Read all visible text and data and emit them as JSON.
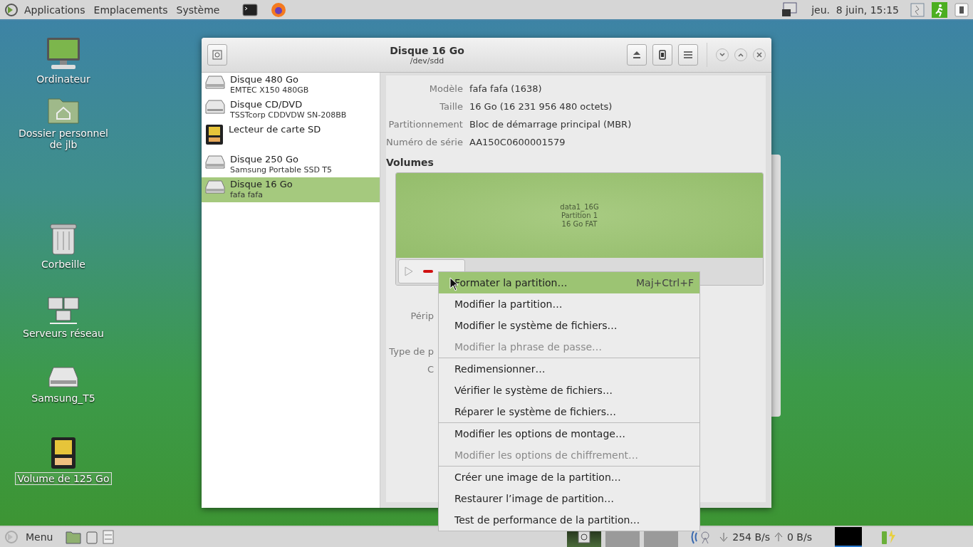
{
  "top_panel": {
    "menus": [
      "Applications",
      "Emplacements",
      "Système"
    ],
    "clock": "jeu.  8 juin, 15:15"
  },
  "desktop_icons": [
    {
      "label": "Ordinateur",
      "kind": "computer",
      "selected": false
    },
    {
      "label": "Dossier personnel de jlb",
      "kind": "home",
      "selected": false
    },
    {
      "label": "Corbeille",
      "kind": "trash",
      "selected": false
    },
    {
      "label": "Serveurs réseau",
      "kind": "network",
      "selected": false
    },
    {
      "label": "Samsung_T5",
      "kind": "drive",
      "selected": false
    },
    {
      "label": "Volume de 125 Go",
      "kind": "card",
      "selected": true
    }
  ],
  "window": {
    "title": "Disque 16 Go",
    "subtitle": "/dev/sdd",
    "drives": [
      {
        "name": "Disque 480 Go",
        "model": "EMTEC X150 480GB",
        "kind": "disk",
        "selected": false
      },
      {
        "name": "Disque CD/DVD",
        "model": "TSSTcorp CDDVDW SN-208BB",
        "kind": "optical",
        "selected": false
      },
      {
        "name": "Lecteur de carte SD",
        "kind": "card",
        "selected": false
      },
      {
        "name": "Disque 250 Go",
        "model": "Samsung Portable SSD T5",
        "kind": "disk",
        "selected": false
      },
      {
        "name": "Disque 16 Go",
        "model": "fafa fafa",
        "kind": "disk",
        "selected": true
      }
    ],
    "details": [
      {
        "label": "Modèle",
        "value": "fafa fafa (1638)"
      },
      {
        "label": "Taille",
        "value": "16 Go (16 231 956 480 octets)"
      },
      {
        "label": "Partitionnement",
        "value": "Bloc de démarrage principal (MBR)"
      },
      {
        "label": "Numéro de série",
        "value": "AA150C0600001579"
      }
    ],
    "volumes_heading": "Volumes",
    "partition": {
      "lines": [
        "data1_16G",
        "Partition 1",
        "16 Go FAT"
      ]
    },
    "covered_labels": [
      "Périp",
      "Type de p",
      "C"
    ]
  },
  "context_menu": [
    {
      "label": "Formater la partition…",
      "shortcut": "Maj+Ctrl+F",
      "selected": true,
      "disabled": false,
      "separator_before": false
    },
    {
      "label": "Modifier la partition…",
      "selected": false,
      "disabled": false,
      "separator_before": false
    },
    {
      "label": "Modifier le système de fichiers…",
      "selected": false,
      "disabled": false,
      "separator_before": false
    },
    {
      "label": "Modifier la phrase de passe…",
      "selected": false,
      "disabled": true,
      "separator_before": false
    },
    {
      "label": "Redimensionner…",
      "selected": false,
      "disabled": false,
      "separator_before": true
    },
    {
      "label": "Vérifier le système de fichiers…",
      "selected": false,
      "disabled": false,
      "separator_before": false
    },
    {
      "label": "Réparer le système de fichiers…",
      "selected": false,
      "disabled": false,
      "separator_before": false
    },
    {
      "label": "Modifier les options de montage…",
      "selected": false,
      "disabled": false,
      "separator_before": true
    },
    {
      "label": "Modifier les options de chiffrement…",
      "selected": false,
      "disabled": true,
      "separator_before": false
    },
    {
      "label": "Créer une image de la partition…",
      "selected": false,
      "disabled": false,
      "separator_before": true
    },
    {
      "label": "Restaurer l’image de partition…",
      "selected": false,
      "disabled": false,
      "separator_before": false
    },
    {
      "label": "Test de performance de la partition…",
      "selected": false,
      "disabled": false,
      "separator_before": false
    }
  ],
  "bottom_panel": {
    "menu_label": "Menu",
    "tasks": [
      {
        "selected": true
      },
      {
        "selected": false
      },
      {
        "selected": false
      }
    ],
    "net_down": "254 B/s",
    "net_up": "0 B/s"
  }
}
